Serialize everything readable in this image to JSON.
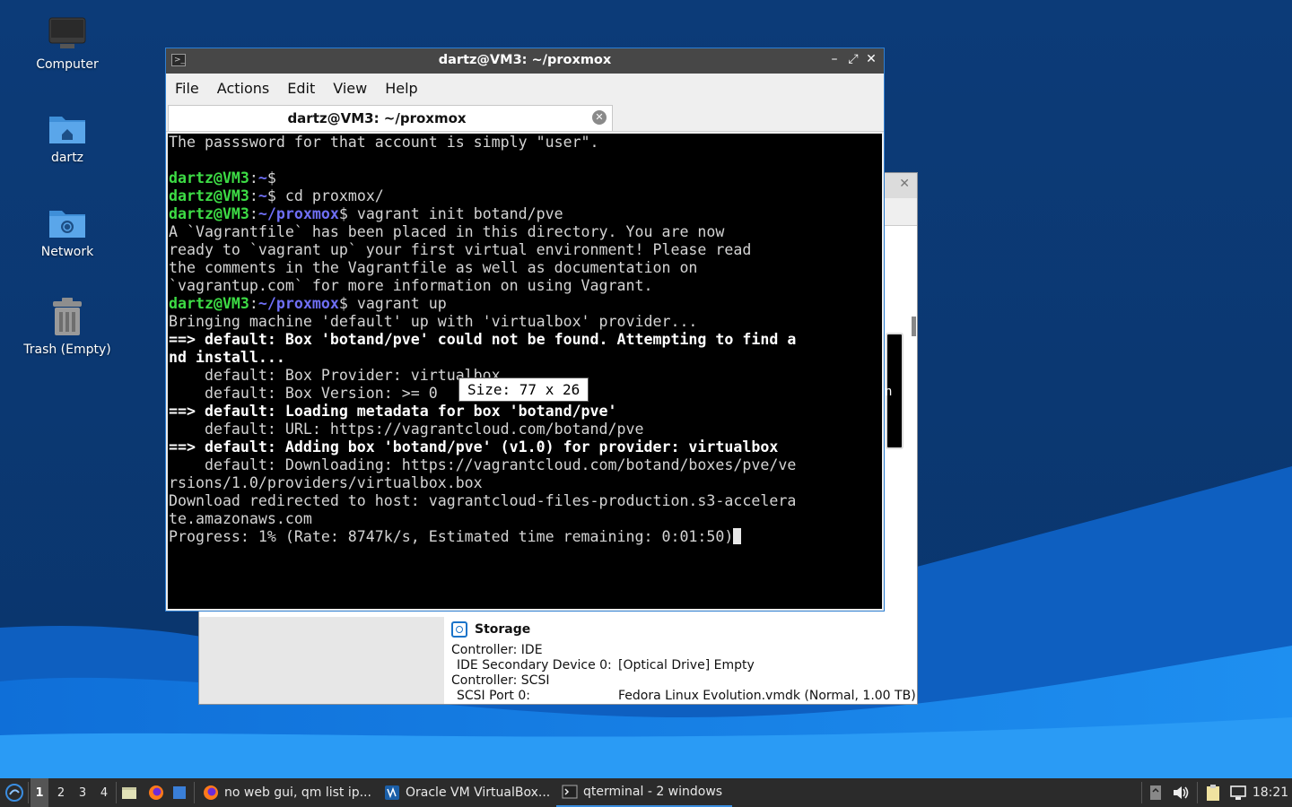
{
  "desktop": {
    "icons": [
      {
        "label": "Computer",
        "icon": "computer-icon"
      },
      {
        "label": "dartz",
        "icon": "home-folder-icon"
      },
      {
        "label": "Network",
        "icon": "network-folder-icon"
      },
      {
        "label": "Trash (Empty)",
        "icon": "trash-icon"
      }
    ]
  },
  "terminal": {
    "title": "dartz@VM3: ~/proxmox",
    "menu": [
      "File",
      "Actions",
      "Edit",
      "View",
      "Help"
    ],
    "tab_label": "dartz@VM3: ~/proxmox",
    "line1": "The passsword for that account is simply \"user\".",
    "prompt_user": "dartz@VM3",
    "home_path": "~",
    "proxmox_path": "~/proxmox",
    "cmd_cd": "cd proxmox/",
    "cmd_init": "vagrant init botand/pve",
    "init_out": [
      "A `Vagrantfile` has been placed in this directory. You are now",
      "ready to `vagrant up` your first virtual environment! Please read",
      "the comments in the Vagrantfile as well as documentation on",
      "`vagrantup.com` for more information on using Vagrant."
    ],
    "cmd_up": "vagrant up",
    "up_bringing": "Bringing machine 'default' up with 'virtualbox' provider...",
    "up_box_missing": "==> default: Box 'botand/pve' could not be found. Attempting to find a",
    "up_box_missing_cont": "nd install...",
    "up_provider": "    default: Box Provider: virtualbox",
    "up_version": "    default: Box Version: >= 0",
    "up_loading": "==> default: Loading metadata for box 'botand/pve'",
    "up_url": "    default: URL: https://vagrantcloud.com/botand/pve",
    "up_adding": "==> default: Adding box 'botand/pve' (v1.0) for provider: virtualbox",
    "up_downloading": "    default: Downloading: https://vagrantcloud.com/botand/boxes/pve/ve",
    "up_downloading_cont": "rsions/1.0/providers/virtualbox.box",
    "up_redirect": "Download redirected to host: vagrantcloud-files-production.s3-accelera",
    "up_redirect_cont": "te.amazonaws.com",
    "up_progress": "Progress: 1% (Rate: 8747k/s, Estimated time remaining: 0:01:50)",
    "resize_tooltip": "Size: 77 x 26"
  },
  "virtualbox": {
    "close_glyph": "✕",
    "preview_char": "n",
    "storage": {
      "heading": "Storage",
      "controller_ide": "Controller: IDE",
      "ide_key": "IDE Secondary Device 0:",
      "ide_value": "[Optical Drive] Empty",
      "controller_scsi": "Controller: SCSI",
      "scsi_key": "SCSI Port 0:",
      "scsi_value": "Fedora Linux Evolution.vmdk (Normal, 1.00 TB)"
    }
  },
  "taskbar": {
    "workspaces": [
      "1",
      "2",
      "3",
      "4"
    ],
    "active_workspace": "1",
    "tasks": [
      {
        "label": "no web gui, qm list ip...",
        "icon": "firefox-icon"
      },
      {
        "label": "Oracle VM VirtualBox...",
        "icon": "virtualbox-icon"
      },
      {
        "label": "qterminal - 2 windows",
        "icon": "terminal-icon"
      }
    ],
    "clock": "18:21"
  }
}
